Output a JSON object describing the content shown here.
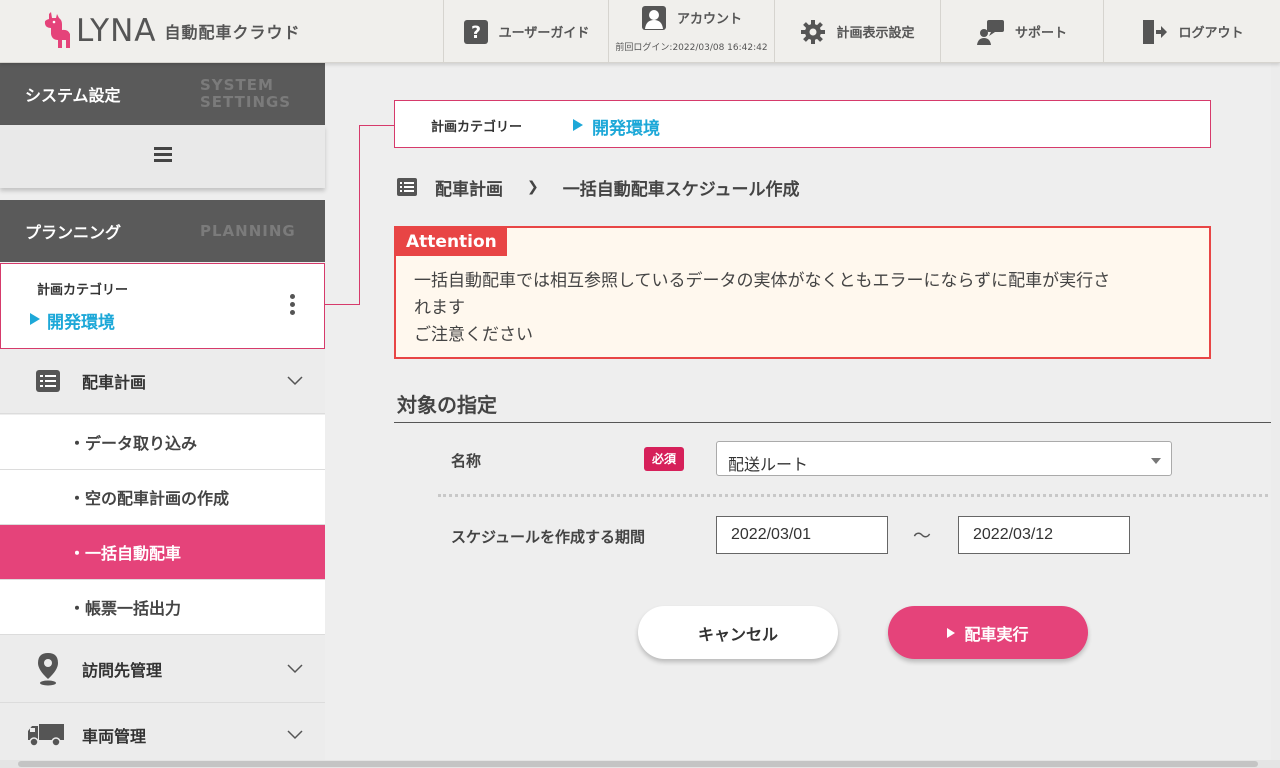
{
  "header": {
    "logo_text": "LYNA",
    "app_name": "自動配車クラウド",
    "nav": {
      "guide": "ユーザーガイド",
      "account": "アカウント",
      "last_login": "前回ログイン:2022/03/08 16:42:42",
      "display_settings": "計画表示設定",
      "support": "サポート",
      "logout": "ログアウト"
    }
  },
  "sidebar": {
    "system": {
      "jp": "システム設定",
      "en_line1": "SYSTEM",
      "en_line2": "SETTINGS"
    },
    "planning": {
      "jp": "プランニング",
      "en": "PLANNING"
    },
    "category": {
      "label": "計画カテゴリー",
      "value": "開発環境"
    },
    "dispatch_plan": "配車計画",
    "sub_items": [
      "・データ取り込み",
      "・空の配車計画の作成",
      "・一括自動配車",
      "・帳票一括出力"
    ],
    "visit_mgmt": "訪問先管理",
    "vehicle_mgmt": "車両管理"
  },
  "main": {
    "category": {
      "label": "計画カテゴリー",
      "value": "開発環境"
    },
    "breadcrumb": {
      "parent": "配車計画",
      "separator": "❯",
      "current": "一括自動配車スケジュール作成"
    },
    "attention": {
      "tag": "Attention",
      "line1": "一括自動配車では相互参照しているデータの実体がなくともエラーにならずに配車が実行さ",
      "line2": "れます",
      "line3": "ご注意ください"
    },
    "section_title": "対象の指定",
    "form": {
      "name_label": "名称",
      "required": "必須",
      "name_value": "配送ルート",
      "period_label": "スケジュールを作成する期間",
      "date_from": "2022/03/01",
      "tilde": "〜",
      "date_to": "2022/03/12"
    },
    "buttons": {
      "cancel": "キャンセル",
      "run": "配車実行"
    }
  },
  "colors": {
    "accent": "#e5437a",
    "category_border": "#d63a6b",
    "link": "#1da8d8",
    "attention_red": "#e84545",
    "attention_bg": "#fff8ee",
    "dark_header": "#5a5a5a"
  }
}
